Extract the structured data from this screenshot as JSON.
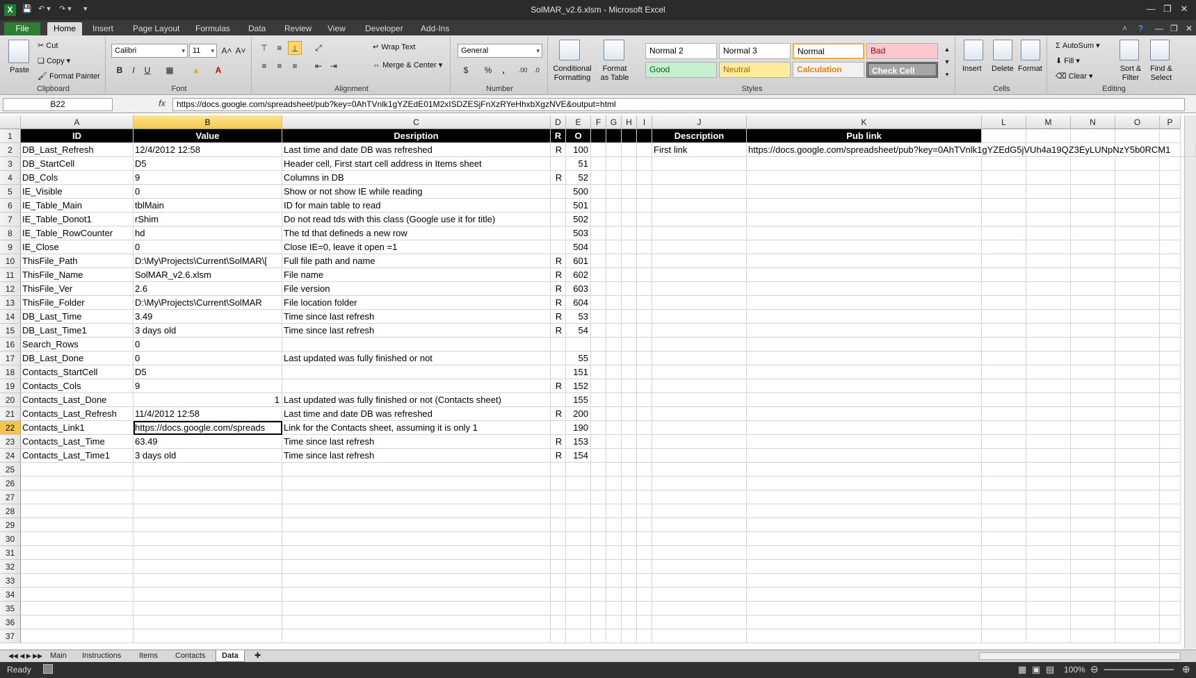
{
  "window": {
    "title": "SolMAR_v2.6.xlsm - Microsoft Excel"
  },
  "ribbon_tabs": [
    "File",
    "Home",
    "Insert",
    "Page Layout",
    "Formulas",
    "Data",
    "Review",
    "View",
    "Developer",
    "Add-Ins"
  ],
  "clipboard": {
    "paste": "Paste",
    "cut": "Cut",
    "copy": "Copy",
    "format_painter": "Format Painter",
    "label": "Clipboard"
  },
  "font": {
    "name": "Calibri",
    "size": "11",
    "label": "Font"
  },
  "alignment": {
    "wrap_text": "Wrap Text",
    "merge_center": "Merge & Center",
    "label": "Alignment"
  },
  "number": {
    "format": "General",
    "label": "Number"
  },
  "styles": {
    "conditional": "Conditional Formatting",
    "format_table": "Format as Table",
    "label": "Styles",
    "cells": [
      "Normal 2",
      "Normal 3",
      "Normal",
      "Bad",
      "Good",
      "Neutral",
      "Calculation",
      "Check Cell"
    ]
  },
  "cells_group": {
    "insert": "Insert",
    "delete": "Delete",
    "format": "Format",
    "label": "Cells"
  },
  "editing": {
    "autosum": "AutoSum",
    "fill": "Fill",
    "clear": "Clear",
    "sort": "Sort & Filter",
    "find": "Find & Select",
    "label": "Editing"
  },
  "formula_bar": {
    "name_box": "B22",
    "fx": "fx",
    "formula": "https://docs.google.com/spreadsheet/pub?key=0AhTVnlk1gYZEdE01M2xISDZESjFnXzRYeHhxbXgzNVE&output=html"
  },
  "columns": [
    "A",
    "B",
    "C",
    "D",
    "E",
    "F",
    "G",
    "H",
    "I",
    "J",
    "K",
    "L",
    "M",
    "N",
    "O",
    "P"
  ],
  "header_row": {
    "A": "ID",
    "B": "Value",
    "C": "Desription",
    "D": "R",
    "E": "O",
    "J": "Description",
    "K": "Pub link"
  },
  "rows": [
    {
      "A": "DB_Last_Refresh",
      "B": "12/4/2012 12:58",
      "C": "Last time and date DB was refreshed",
      "D": "R",
      "E": "100",
      "J": "First link",
      "K": "https://docs.google.com/spreadsheet/pub?key=0AhTVnlk1gYZEdG5jVUh4a19QZ3EyLUNpNzY5b0RCM1"
    },
    {
      "A": "DB_StartCell",
      "B": "D5",
      "C": "Header cell, First start cell address in Items sheet",
      "D": "",
      "E": "51"
    },
    {
      "A": "DB_Cols",
      "B": "9",
      "C": "Columns in DB",
      "D": "R",
      "E": "52"
    },
    {
      "A": "IE_Visible",
      "B": "0",
      "C": "Show or not show IE while reading",
      "D": "",
      "E": "500"
    },
    {
      "A": "IE_Table_Main",
      "B": "tblMain",
      "C": "ID for main table to read",
      "D": "",
      "E": "501"
    },
    {
      "A": "IE_Table_Donot1",
      "B": "rShim",
      "C": "Do not read tds with this class (Google use it for title)",
      "D": "",
      "E": "502"
    },
    {
      "A": "IE_Table_RowCounter",
      "B": "hd",
      "C": "The td that defineds a new row",
      "D": "",
      "E": "503"
    },
    {
      "A": "IE_Close",
      "B": "0",
      "C": "Close IE=0, leave it open =1",
      "D": "",
      "E": "504"
    },
    {
      "A": "ThisFile_Path",
      "B": "D:\\My\\Projects\\Current\\SolMAR\\[",
      "C": "Full file path and name",
      "D": "R",
      "E": "601"
    },
    {
      "A": "ThisFile_Name",
      "B": "SolMAR_v2.6.xlsm",
      "C": "File name",
      "D": "R",
      "E": "602"
    },
    {
      "A": "ThisFile_Ver",
      "B": "2.6",
      "C": "File version",
      "D": "R",
      "E": "603"
    },
    {
      "A": "ThisFile_Folder",
      "B": "D:\\My\\Projects\\Current\\SolMAR",
      "C": "File location folder",
      "D": "R",
      "E": "604"
    },
    {
      "A": "DB_Last_Time",
      "B": "3.49",
      "C": "Time since last refresh",
      "D": "R",
      "E": "53"
    },
    {
      "A": "DB_Last_Time1",
      "B": "3 days old",
      "C": "Time since last refresh",
      "D": "R",
      "E": "54"
    },
    {
      "A": "Search_Rows",
      "B": "0",
      "C": "",
      "D": "",
      "E": ""
    },
    {
      "A": "DB_Last_Done",
      "B": "0",
      "C": "Last updated was fully finished or not",
      "D": "",
      "E": "55"
    },
    {
      "A": "Contacts_StartCell",
      "B": "D5",
      "C": "",
      "D": "",
      "E": "151"
    },
    {
      "A": "Contacts_Cols",
      "B": "9",
      "C": "",
      "D": "R",
      "E": "152"
    },
    {
      "A": "Contacts_Last_Done",
      "B": "1",
      "C": "Last updated was fully finished or not (Contacts sheet)",
      "D": "",
      "E": "155"
    },
    {
      "A": "Contacts_Last_Refresh",
      "B": "11/4/2012 12:58",
      "C": "Last time and date DB was refreshed",
      "D": "R",
      "E": "200"
    },
    {
      "A": "Contacts_Link1",
      "B": "https://docs.google.com/spreads",
      "C": "Link for the Contacts sheet, assuming it is only 1",
      "D": "",
      "E": "190"
    },
    {
      "A": "Contacts_Last_Time",
      "B": "63.49",
      "C": "Time since last refresh",
      "D": "R",
      "E": "153"
    },
    {
      "A": "Contacts_Last_Time1",
      "B": "3 days old",
      "C": "Time since last refresh",
      "D": "R",
      "E": "154"
    }
  ],
  "row_numbers": [
    "1",
    "2",
    "3",
    "4",
    "5",
    "6",
    "7",
    "8",
    "9",
    "10",
    "11",
    "12",
    "13",
    "14",
    "15",
    "16",
    "17",
    "18",
    "19",
    "20",
    "21",
    "22",
    "23",
    "24",
    "25",
    "26",
    "27",
    "28",
    "29",
    "30",
    "31",
    "32",
    "33",
    "34",
    "35",
    "36",
    "37"
  ],
  "sheet_tabs": [
    "Main",
    "Instructions",
    "Items",
    "Contacts",
    "Data"
  ],
  "status": {
    "ready": "Ready",
    "zoom": "100%"
  }
}
